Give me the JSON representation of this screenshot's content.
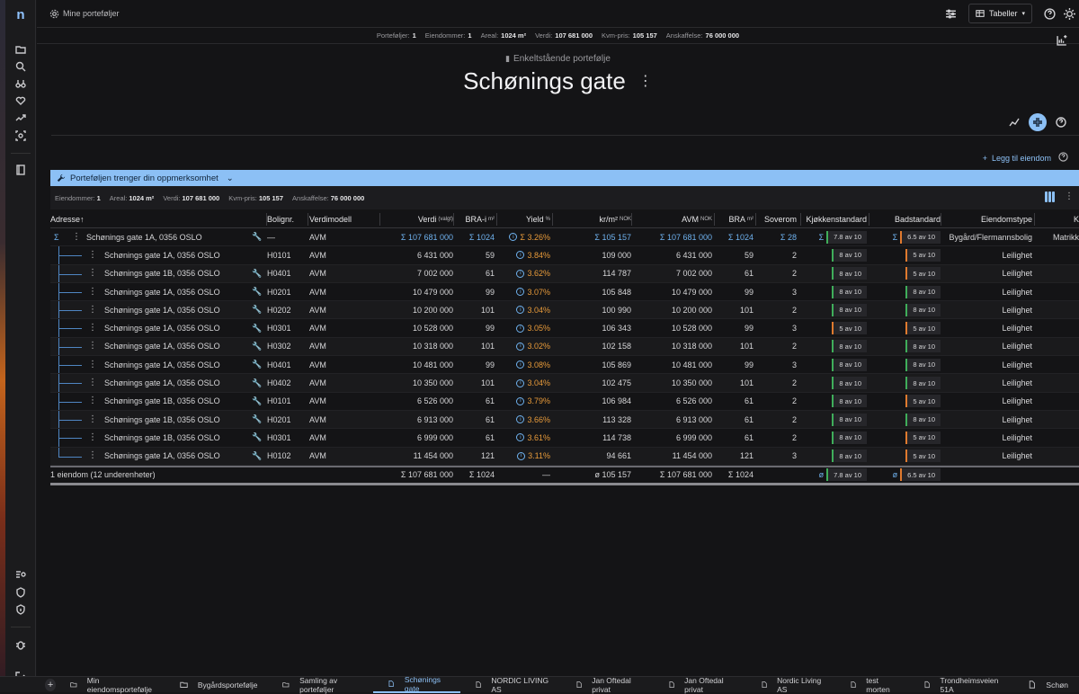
{
  "topbar": {
    "breadcrumb": "Mine porteføljer",
    "view_select": "Tabeller"
  },
  "stats": [
    [
      "Porteføljer:",
      "1"
    ],
    [
      "Eiendommer:",
      "1"
    ],
    [
      "Areal:",
      "1024 m²"
    ],
    [
      "Verdi:",
      "107 681 000"
    ],
    [
      "Kvm-pris:",
      "105 157"
    ],
    [
      "Anskaffelse:",
      "76 000 000"
    ]
  ],
  "header": {
    "subtitle": "Enkeltstående portefølje",
    "title": "Schønings gate"
  },
  "add_label": "Legg til eiendom",
  "alert": "Porteføljen trenger din oppmerksomhet",
  "summary": [
    [
      "Eiendommer:",
      "1"
    ],
    [
      "Areal:",
      "1024 m²"
    ],
    [
      "Verdi:",
      "107 681 000"
    ],
    [
      "Kvm-pris:",
      "105 157"
    ],
    [
      "Anskaffelse:",
      "76 000 000"
    ]
  ],
  "columns": {
    "adresse": "Adresse",
    "bolignr": "Bolignr.",
    "verdimodell": "Verdimodell",
    "verdi": "Verdi",
    "verdi_sup": "(valgt)",
    "brai": "BRA-i",
    "brai_sup": "m²",
    "yield": "Yield",
    "yield_sup": "%",
    "krm2": "kr/m²",
    "krm2_sup": "NOK",
    "avm": "AVM",
    "avm_sup": "NOK",
    "bra": "BRA",
    "bra_sup": "m²",
    "soverom": "Soverom",
    "kjokken": "Kjøkkenstandard",
    "bad": "Badstandard",
    "type": "Eiendomstype",
    "more": "K"
  },
  "parent": {
    "sigma": "Σ",
    "adresse": "Schønings gate 1A, 0356 OSLO",
    "bolignr": "—",
    "verdimodell": "AVM",
    "verdi": "Σ 107 681 000",
    "brai": "Σ 1024",
    "yield": "Σ 3.26%",
    "krm2": "Σ 105 157",
    "avm": "Σ 107 681 000",
    "bra": "Σ 1024",
    "soverom": "Σ 28",
    "kjokken_prefix": "Σ",
    "kjokken": "7.8 av 10",
    "bad_prefix": "Σ",
    "bad": "6.5 av 10",
    "type": "Bygård/Flermannsbolig",
    "extra": "Matrikk"
  },
  "rows": [
    {
      "adresse": "Schønings gate 1A, 0356 OSLO",
      "wrench": false,
      "bolignr": "H0101",
      "verdimodell": "AVM",
      "verdi": "6 431 000",
      "brai": "59",
      "yield": "3.84%",
      "krm2": "109 000",
      "avm": "6 431 000",
      "bra": "59",
      "soverom": "2",
      "kjokken": "8 av 10",
      "kc": "#3fae5a",
      "bad": "5 av 10",
      "bc": "#e07a2e",
      "type": "Leilighet"
    },
    {
      "adresse": "Schønings gate 1B, 0356 OSLO",
      "wrench": true,
      "bolignr": "H0401",
      "verdimodell": "AVM",
      "verdi": "7 002 000",
      "brai": "61",
      "yield": "3.62%",
      "krm2": "114 787",
      "avm": "7 002 000",
      "bra": "61",
      "soverom": "2",
      "kjokken": "8 av 10",
      "kc": "#3fae5a",
      "bad": "5 av 10",
      "bc": "#e07a2e",
      "type": "Leilighet"
    },
    {
      "adresse": "Schønings gate 1A, 0356 OSLO",
      "wrench": true,
      "bolignr": "H0201",
      "verdimodell": "AVM",
      "verdi": "10 479 000",
      "brai": "99",
      "yield": "3.07%",
      "krm2": "105 848",
      "avm": "10 479 000",
      "bra": "99",
      "soverom": "3",
      "kjokken": "8 av 10",
      "kc": "#3fae5a",
      "bad": "8 av 10",
      "bc": "#3fae5a",
      "type": "Leilighet"
    },
    {
      "adresse": "Schønings gate 1A, 0356 OSLO",
      "wrench": true,
      "bolignr": "H0202",
      "verdimodell": "AVM",
      "verdi": "10 200 000",
      "brai": "101",
      "yield": "3.04%",
      "krm2": "100 990",
      "avm": "10 200 000",
      "bra": "101",
      "soverom": "2",
      "kjokken": "8 av 10",
      "kc": "#3fae5a",
      "bad": "8 av 10",
      "bc": "#3fae5a",
      "type": "Leilighet"
    },
    {
      "adresse": "Schønings gate 1A, 0356 OSLO",
      "wrench": true,
      "bolignr": "H0301",
      "verdimodell": "AVM",
      "verdi": "10 528 000",
      "brai": "99",
      "yield": "3.05%",
      "krm2": "106 343",
      "avm": "10 528 000",
      "bra": "99",
      "soverom": "3",
      "kjokken": "5 av 10",
      "kc": "#e07a2e",
      "bad": "5 av 10",
      "bc": "#e07a2e",
      "type": "Leilighet"
    },
    {
      "adresse": "Schønings gate 1A, 0356 OSLO",
      "wrench": true,
      "bolignr": "H0302",
      "verdimodell": "AVM",
      "verdi": "10 318 000",
      "brai": "101",
      "yield": "3.02%",
      "krm2": "102 158",
      "avm": "10 318 000",
      "bra": "101",
      "soverom": "2",
      "kjokken": "8 av 10",
      "kc": "#3fae5a",
      "bad": "8 av 10",
      "bc": "#3fae5a",
      "type": "Leilighet"
    },
    {
      "adresse": "Schønings gate 1A, 0356 OSLO",
      "wrench": true,
      "bolignr": "H0401",
      "verdimodell": "AVM",
      "verdi": "10 481 000",
      "brai": "99",
      "yield": "3.08%",
      "krm2": "105 869",
      "avm": "10 481 000",
      "bra": "99",
      "soverom": "3",
      "kjokken": "8 av 10",
      "kc": "#3fae5a",
      "bad": "8 av 10",
      "bc": "#3fae5a",
      "type": "Leilighet"
    },
    {
      "adresse": "Schønings gate 1A, 0356 OSLO",
      "wrench": true,
      "bolignr": "H0402",
      "verdimodell": "AVM",
      "verdi": "10 350 000",
      "brai": "101",
      "yield": "3.04%",
      "krm2": "102 475",
      "avm": "10 350 000",
      "bra": "101",
      "soverom": "2",
      "kjokken": "8 av 10",
      "kc": "#3fae5a",
      "bad": "8 av 10",
      "bc": "#3fae5a",
      "type": "Leilighet"
    },
    {
      "adresse": "Schønings gate 1B, 0356 OSLO",
      "wrench": true,
      "bolignr": "H0101",
      "verdimodell": "AVM",
      "verdi": "6 526 000",
      "brai": "61",
      "yield": "3.79%",
      "krm2": "106 984",
      "avm": "6 526 000",
      "bra": "61",
      "soverom": "2",
      "kjokken": "8 av 10",
      "kc": "#3fae5a",
      "bad": "5 av 10",
      "bc": "#e07a2e",
      "type": "Leilighet"
    },
    {
      "adresse": "Schønings gate 1B, 0356 OSLO",
      "wrench": true,
      "bolignr": "H0201",
      "verdimodell": "AVM",
      "verdi": "6 913 000",
      "brai": "61",
      "yield": "3.66%",
      "krm2": "113 328",
      "avm": "6 913 000",
      "bra": "61",
      "soverom": "2",
      "kjokken": "8 av 10",
      "kc": "#3fae5a",
      "bad": "8 av 10",
      "bc": "#3fae5a",
      "type": "Leilighet"
    },
    {
      "adresse": "Schønings gate 1B, 0356 OSLO",
      "wrench": true,
      "bolignr": "H0301",
      "verdimodell": "AVM",
      "verdi": "6 999 000",
      "brai": "61",
      "yield": "3.61%",
      "krm2": "114 738",
      "avm": "6 999 000",
      "bra": "61",
      "soverom": "2",
      "kjokken": "8 av 10",
      "kc": "#3fae5a",
      "bad": "5 av 10",
      "bc": "#e07a2e",
      "type": "Leilighet"
    },
    {
      "adresse": "Schønings gate 1A, 0356 OSLO",
      "wrench": true,
      "bolignr": "H0102",
      "verdimodell": "AVM",
      "verdi": "11 454 000",
      "brai": "121",
      "yield": "3.11%",
      "krm2": "94 661",
      "avm": "11 454 000",
      "bra": "121",
      "soverom": "3",
      "kjokken": "8 av 10",
      "kc": "#3fae5a",
      "bad": "5 av 10",
      "bc": "#e07a2e",
      "type": "Leilighet"
    }
  ],
  "totals": {
    "label": "1 eiendom (12 underenheter)",
    "verdi": "Σ 107 681 000",
    "brai": "Σ 1024",
    "yield": "—",
    "krm2": "ø  105 157",
    "avm": "Σ 107 681 000",
    "bra": "Σ 1024",
    "kjokken_prefix": "ø",
    "kjokken": "7.8 av 10",
    "bad_prefix": "ø",
    "bad": "6.5 av 10"
  },
  "bottom_tabs": [
    "Min eiendomsportefølje",
    "Bygårdsportefølje",
    "Samling av porteføljer",
    "Schønings gate",
    "NORDIC LIVING AS",
    "Jan Oftedal privat",
    "Jan Oftedal privat",
    "Nordic Living AS",
    "test morten",
    "Trondheimsveien 51A",
    "Schøn"
  ],
  "active_tab": 3,
  "colors": {
    "accent": "#8cc0f5",
    "good": "#3fae5a",
    "warn": "#e07a2e",
    "yield": "#e79a3a"
  }
}
